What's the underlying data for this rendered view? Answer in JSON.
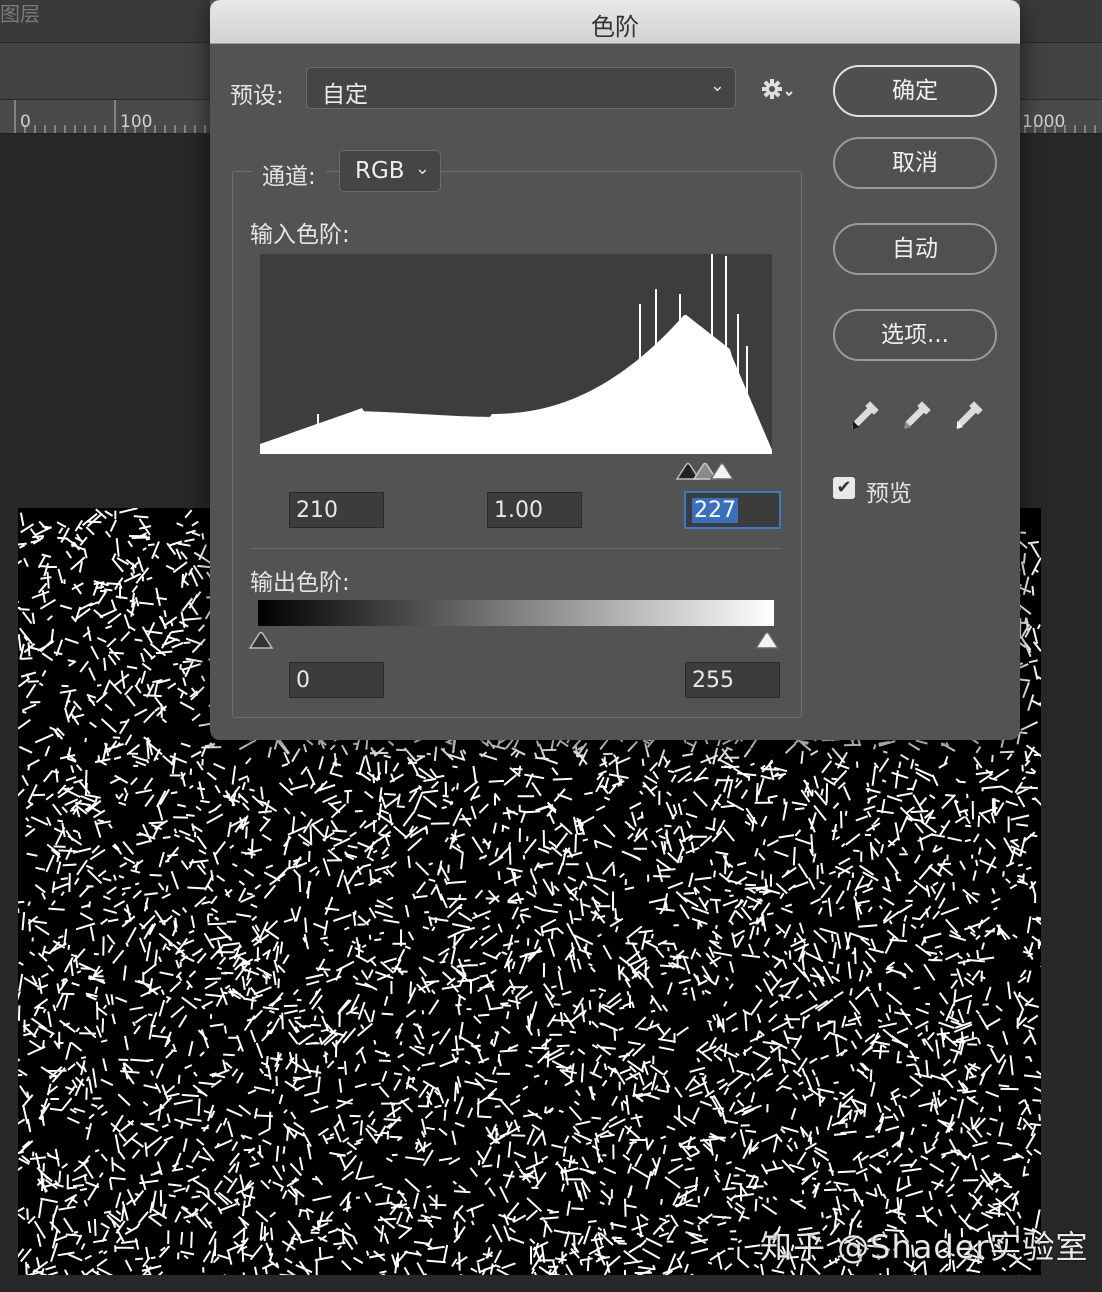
{
  "app": {
    "layers_panel_label": "图层"
  },
  "ruler": {
    "labels": [
      "0",
      "100",
      "1000"
    ]
  },
  "watermark": "知乎 @Shader实验室",
  "dialog": {
    "title": "色阶",
    "preset": {
      "label": "预设:",
      "value": "自定"
    },
    "gear_icon": "gear-icon",
    "channel": {
      "label": "通道:",
      "value": "RGB"
    },
    "input_levels": {
      "label": "输入色阶:",
      "black": "210",
      "gamma": "1.00",
      "white": "227"
    },
    "output_levels": {
      "label": "输出色阶:",
      "black": "0",
      "white": "255"
    },
    "buttons": {
      "ok": "确定",
      "cancel": "取消",
      "auto": "自动",
      "options": "选项..."
    },
    "eyedroppers": [
      "black-point-eyedropper-icon",
      "gray-point-eyedropper-icon",
      "white-point-eyedropper-icon"
    ],
    "preview": {
      "label": "预览",
      "checked": true
    },
    "colors": {
      "active_field": "#3a6fbd",
      "dialog_bg": "#535353"
    }
  }
}
